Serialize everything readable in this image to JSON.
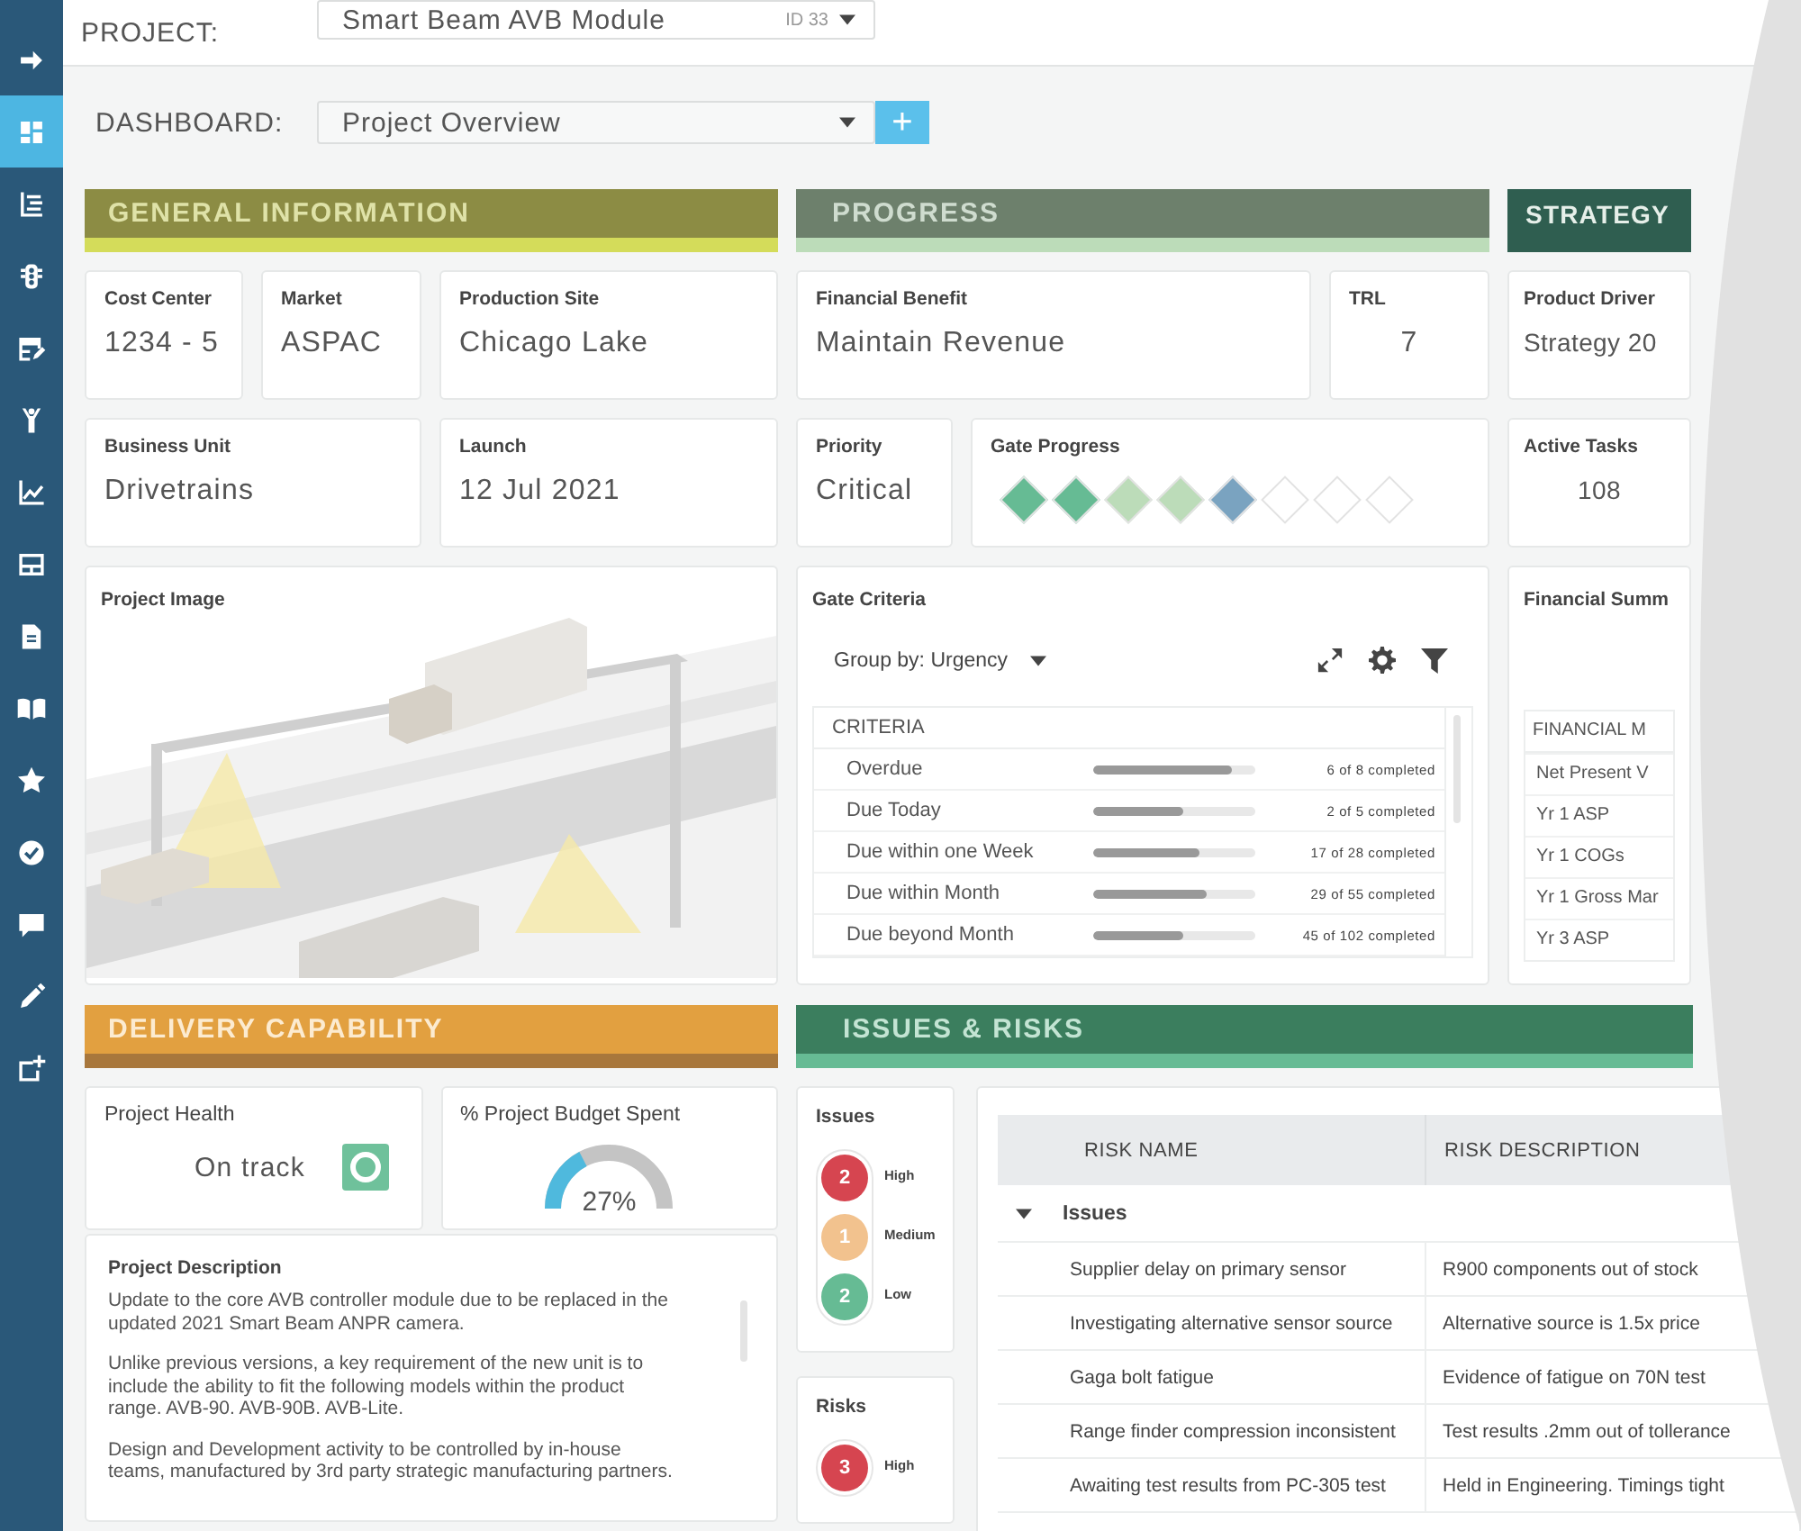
{
  "sidebar": {
    "items": [
      {
        "kind": "arrow",
        "selected": false
      },
      {
        "kind": "dashboard",
        "selected": true
      },
      {
        "kind": "list",
        "selected": false
      },
      {
        "kind": "traffic",
        "selected": false
      },
      {
        "kind": "table-edit",
        "selected": false
      },
      {
        "kind": "person",
        "selected": false
      },
      {
        "kind": "chart",
        "selected": false
      },
      {
        "kind": "layout",
        "selected": false
      },
      {
        "kind": "document",
        "selected": false
      },
      {
        "kind": "book",
        "selected": false
      },
      {
        "kind": "star",
        "selected": false
      },
      {
        "kind": "check",
        "selected": false
      },
      {
        "kind": "chat",
        "selected": false
      },
      {
        "kind": "pencil",
        "selected": false
      },
      {
        "kind": "add-window",
        "selected": false
      }
    ]
  },
  "project": {
    "label": "PROJECT:",
    "name": "Smart Beam AVB Module",
    "id": "ID 33"
  },
  "dashboard": {
    "label": "DASHBOARD:",
    "value": "Project Overview",
    "add_button": "+"
  },
  "general_information": {
    "title": "GENERAL INFORMATION",
    "fields": [
      {
        "label": "Cost Center",
        "value": "1234 - 5"
      },
      {
        "label": "Market",
        "value": "ASPAC"
      },
      {
        "label": "Production Site",
        "value": "Chicago Lake"
      },
      {
        "label": "Business Unit",
        "value": "Drivetrains"
      },
      {
        "label": "Launch",
        "value": "12 Jul 2021"
      }
    ],
    "project_image": {
      "title": "Project Image"
    }
  },
  "progress": {
    "title": "PROGRESS",
    "financial_benefit": {
      "label": "Financial Benefit",
      "value": "Maintain Revenue"
    },
    "trl": {
      "label": "TRL",
      "value": "7"
    },
    "priority": {
      "label": "Priority",
      "value": "Critical"
    },
    "gate_progress": {
      "label": "Gate Progress",
      "gates": [
        {
          "color": "#66bb94"
        },
        {
          "color": "#66bb94"
        },
        {
          "color": "#bcdcb9"
        },
        {
          "color": "#bcdcb9"
        },
        {
          "color": "#7aa3c0"
        },
        {
          "color": "#ffffff"
        },
        {
          "color": "#ffffff"
        },
        {
          "color": "#ffffff"
        }
      ]
    },
    "gate_criteria": {
      "title": "Gate Criteria",
      "group_by": "Group by: Urgency",
      "column": "CRITERIA",
      "rows": [
        {
          "name": "Overdue",
          "level": 0.86,
          "reading": "6 of 8 completed"
        },
        {
          "name": "Due Today",
          "level": 0.55,
          "reading": "2 of 5 completed"
        },
        {
          "name": "Due within one Week",
          "level": 0.65,
          "reading": "17 of 28 completed"
        },
        {
          "name": "Due within Month",
          "level": 0.7,
          "reading": "29 of 55 completed"
        },
        {
          "name": "Due beyond Month",
          "level": 0.55,
          "reading": "45 of 102 completed"
        }
      ]
    }
  },
  "strategy": {
    "title": "STRATEGY",
    "product_driver": {
      "label": "Product Driver",
      "value": "Strategy 20"
    },
    "active_tasks": {
      "label": "Active Tasks",
      "value": "108"
    },
    "financial_summary": {
      "title": "Financial Summ",
      "column": "FINANCIAL M",
      "rows": [
        "Net Present V",
        "Yr 1 ASP",
        "Yr 1 COGs",
        "Yr 1 Gross Mar",
        "Yr 3 ASP"
      ]
    }
  },
  "delivery_capability": {
    "title": "DELIVERY CAPABILITY",
    "project_health": {
      "label": "Project Health",
      "value": "On track"
    },
    "budget": {
      "label": "% Project Budget Spent",
      "level": 0.27,
      "reading": "27%"
    },
    "description": {
      "title": "Project Description",
      "paragraphs": [
        "Update to the core AVB controller module due to be replaced in the updated 2021 Smart Beam ANPR camera.",
        "Unlike previous versions, a key requirement of the new unit is to include the ability to fit the following models within the product range. AVB-90. AVB-90B. AVB-Lite.",
        "Design and Development activity to be controlled by in-house teams, manufactured by 3rd party strategic manufacturing partners."
      ]
    }
  },
  "issues_risks": {
    "title": "ISSUES & RISKS",
    "issues": {
      "title": "Issues",
      "levels": [
        {
          "count": "2",
          "label": "High",
          "color": "#d64550"
        },
        {
          "count": "1",
          "label": "Medium",
          "color": "#f2c28e"
        },
        {
          "count": "2",
          "label": "Low",
          "color": "#66bb94"
        }
      ]
    },
    "risks": {
      "title": "Risks",
      "levels": [
        {
          "count": "3",
          "label": "High",
          "color": "#d64550"
        }
      ]
    },
    "table": {
      "columns": [
        "RISK NAME",
        "RISK DESCRIPTION"
      ],
      "groups": [
        {
          "name": "Issues",
          "expanded": true,
          "rows": [
            {
              "name": "Supplier delay on primary sensor",
              "description": "R900 components out of stock"
            },
            {
              "name": "Investigating alternative sensor source",
              "description": "Alternative source is 1.5x price"
            },
            {
              "name": "Gaga bolt fatigue",
              "description": "Evidence of fatigue on 70N test"
            },
            {
              "name": "Range finder compression inconsistent",
              "description": "Test results .2mm out of tollerance"
            },
            {
              "name": "Awaiting test results from PC-305 test",
              "description": "Held in Engineering. Timings tight"
            }
          ]
        }
      ]
    }
  }
}
